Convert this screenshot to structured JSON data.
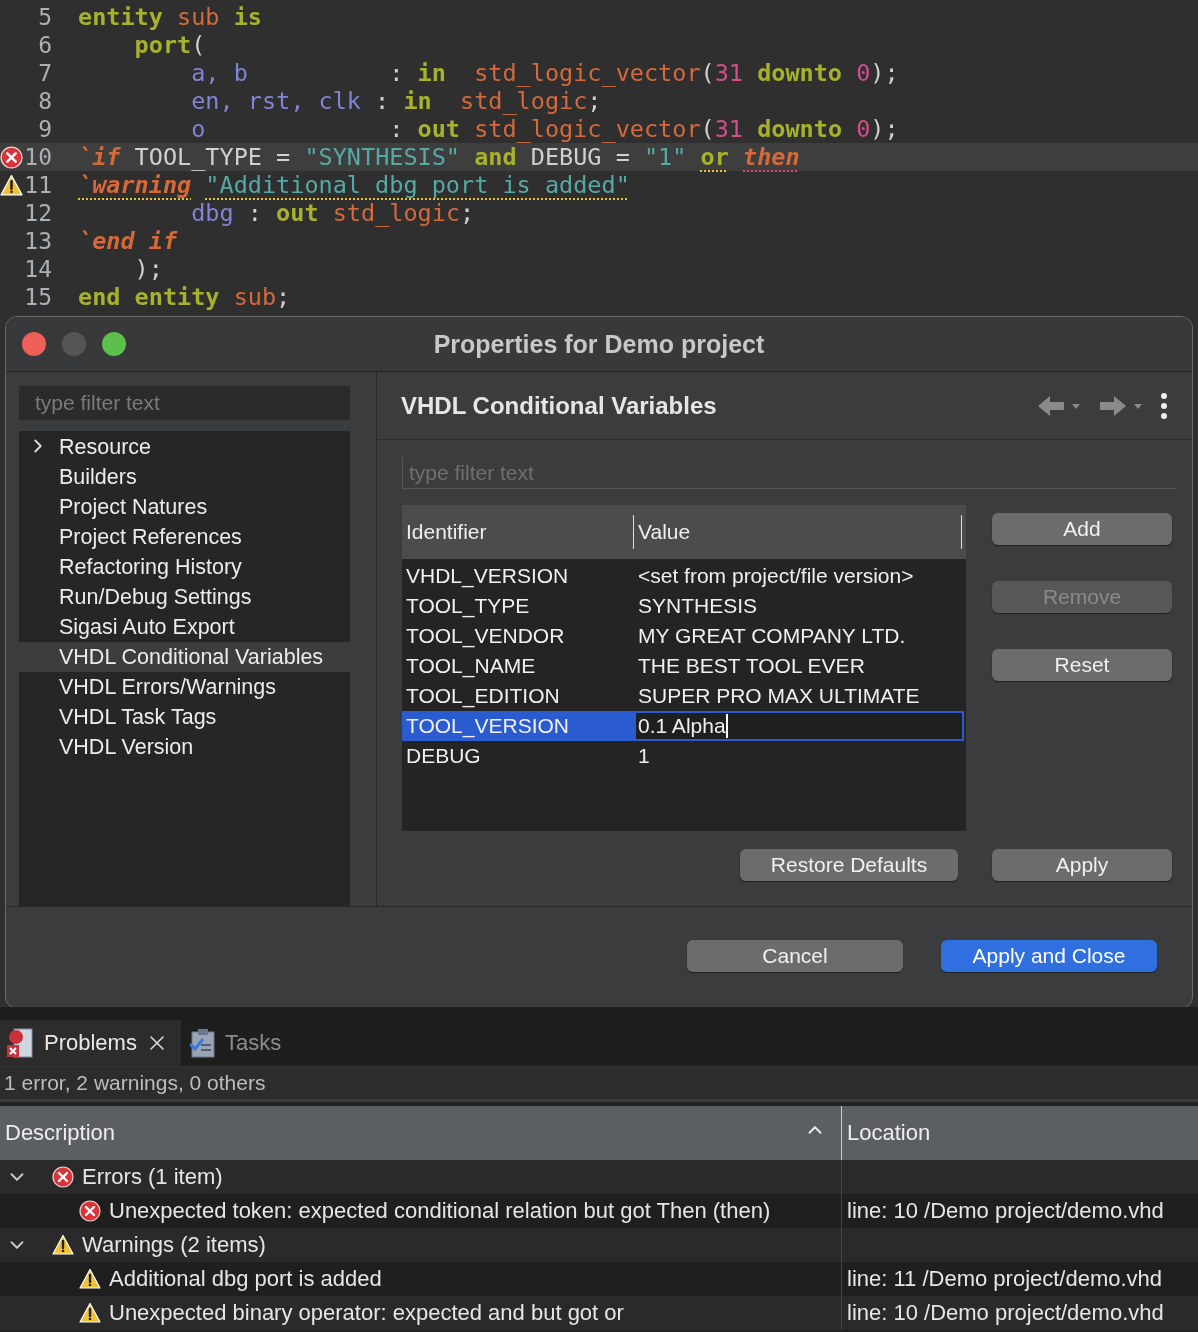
{
  "editor": {
    "lines": [
      {
        "number": "5",
        "kind": "code",
        "current": false,
        "tokens": [
          {
            "text": "entity",
            "kind": "keyword"
          },
          {
            "text": " sub",
            "kind": "type"
          },
          {
            "text": " is",
            "kind": "keyword"
          }
        ]
      },
      {
        "number": "6",
        "kind": "code",
        "current": false,
        "tokens": [
          {
            "text": "    port",
            "kind": "keyword"
          },
          {
            "text": "(",
            "kind": "plain"
          }
        ]
      },
      {
        "number": "7",
        "kind": "code",
        "current": false,
        "tokens": [
          {
            "text": "        a, b",
            "kind": "identifier"
          },
          {
            "text": "          : ",
            "kind": "plain"
          },
          {
            "text": "in",
            "kind": "keyword"
          },
          {
            "text": "  std_logic_vector",
            "kind": "type"
          },
          {
            "text": "(",
            "kind": "plain"
          },
          {
            "text": "31",
            "kind": "number"
          },
          {
            "text": " downto ",
            "kind": "keyword"
          },
          {
            "text": "0",
            "kind": "number"
          },
          {
            "text": ");",
            "kind": "plain"
          }
        ]
      },
      {
        "number": "8",
        "kind": "code",
        "current": false,
        "tokens": [
          {
            "text": "        en, rst, clk",
            "kind": "identifier"
          },
          {
            "text": " : ",
            "kind": "plain"
          },
          {
            "text": "in",
            "kind": "keyword"
          },
          {
            "text": "  std_logic",
            "kind": "type"
          },
          {
            "text": ";",
            "kind": "plain"
          }
        ]
      },
      {
        "number": "9",
        "kind": "code",
        "current": false,
        "tokens": [
          {
            "text": "        o",
            "kind": "identifier"
          },
          {
            "text": "             : ",
            "kind": "plain"
          },
          {
            "text": "out",
            "kind": "keyword"
          },
          {
            "text": " std_logic_vector",
            "kind": "type"
          },
          {
            "text": "(",
            "kind": "plain"
          },
          {
            "text": "31",
            "kind": "number"
          },
          {
            "text": " downto ",
            "kind": "keyword"
          },
          {
            "text": "0",
            "kind": "number"
          },
          {
            "text": ");",
            "kind": "plain"
          }
        ]
      },
      {
        "number": "10",
        "kind": "error",
        "current": true,
        "tokens": [
          {
            "text": "`if",
            "kind": "directive"
          },
          {
            "text": " TOOL_TYPE = ",
            "kind": "plain"
          },
          {
            "text": "\"SYNTHESIS\"",
            "kind": "string"
          },
          {
            "text": " and",
            "kind": "keyword"
          },
          {
            "text": " DEBUG = ",
            "kind": "plain"
          },
          {
            "text": "\"1\"",
            "kind": "string"
          },
          {
            "text": " or",
            "kind": "keyword",
            "warning_mark": true
          },
          {
            "text": " then",
            "kind": "directive",
            "error_mark": true
          }
        ]
      },
      {
        "number": "11",
        "kind": "warning",
        "current": false,
        "tokens": [
          {
            "text": "`warning",
            "kind": "directive",
            "warning_mark": true
          },
          {
            "text": " \"Additional dbg port is added\"",
            "kind": "string",
            "warning_mark": true
          }
        ]
      },
      {
        "number": "12",
        "kind": "code",
        "current": false,
        "tokens": [
          {
            "text": "        dbg",
            "kind": "identifier"
          },
          {
            "text": " : ",
            "kind": "plain"
          },
          {
            "text": "out",
            "kind": "keyword"
          },
          {
            "text": " std_logic",
            "kind": "type"
          },
          {
            "text": ";",
            "kind": "plain"
          }
        ]
      },
      {
        "number": "13",
        "kind": "code",
        "current": false,
        "tokens": [
          {
            "text": "`end if",
            "kind": "directive"
          }
        ]
      },
      {
        "number": "14",
        "kind": "code",
        "current": false,
        "tokens": [
          {
            "text": "    );",
            "kind": "plain"
          }
        ]
      },
      {
        "number": "15",
        "kind": "code",
        "current": false,
        "tokens": [
          {
            "text": "end entity",
            "kind": "keyword"
          },
          {
            "text": " sub",
            "kind": "type"
          },
          {
            "text": ";",
            "kind": "plain"
          }
        ]
      }
    ]
  },
  "dialog": {
    "title": "Properties for Demo project",
    "sidebar": {
      "filter_placeholder": "type filter text",
      "items": [
        {
          "label": "Resource",
          "kind": "folder",
          "selected": false
        },
        {
          "label": "Builders",
          "kind": "page",
          "selected": false
        },
        {
          "label": "Project Natures",
          "kind": "page",
          "selected": false
        },
        {
          "label": "Project References",
          "kind": "page",
          "selected": false
        },
        {
          "label": "Refactoring History",
          "kind": "page",
          "selected": false
        },
        {
          "label": "Run/Debug Settings",
          "kind": "page",
          "selected": false
        },
        {
          "label": "Sigasi Auto Export",
          "kind": "page",
          "selected": false
        },
        {
          "label": "VHDL Conditional Variables",
          "kind": "page",
          "selected": true
        },
        {
          "label": "VHDL Errors/Warnings",
          "kind": "page",
          "selected": false
        },
        {
          "label": "VHDL Task Tags",
          "kind": "page",
          "selected": false
        },
        {
          "label": "VHDL Version",
          "kind": "page",
          "selected": false
        }
      ]
    },
    "page": {
      "title": "VHDL Conditional Variables",
      "filter_placeholder": "type filter text",
      "columns": [
        "Identifier",
        "Value"
      ],
      "rows": [
        {
          "identifier": "VHDL_VERSION",
          "value": "<set from project/file version>",
          "selected": false
        },
        {
          "identifier": "TOOL_TYPE",
          "value": "SYNTHESIS",
          "selected": false
        },
        {
          "identifier": "TOOL_VENDOR",
          "value": "MY GREAT COMPANY LTD.",
          "selected": false
        },
        {
          "identifier": "TOOL_NAME",
          "value": "THE BEST TOOL EVER",
          "selected": false
        },
        {
          "identifier": "TOOL_EDITION",
          "value": "SUPER PRO MAX ULTIMATE",
          "selected": false
        },
        {
          "identifier": "TOOL_VERSION",
          "value": "0.1 Alpha",
          "selected": true
        },
        {
          "identifier": "DEBUG",
          "value": "1",
          "selected": false
        }
      ],
      "side_buttons": [
        {
          "label": "Add",
          "disabled": false
        },
        {
          "label": "Remove",
          "disabled": true
        },
        {
          "label": "Reset",
          "disabled": false
        }
      ],
      "restore_defaults": "Restore Defaults",
      "apply": "Apply"
    },
    "footer_buttons": [
      {
        "label": "Cancel",
        "kind": "normal"
      },
      {
        "label": "Apply and Close",
        "kind": "primary"
      }
    ]
  },
  "problems": {
    "tabs": [
      {
        "label": "Problems",
        "selected": true
      },
      {
        "label": "Tasks",
        "selected": false
      }
    ],
    "summary": "1 error, 2 warnings, 0 others",
    "columns": [
      "Description",
      "Location"
    ],
    "groups": [
      {
        "label": "Errors (1 item)",
        "kind": "error",
        "expanded": true,
        "items": [
          {
            "description": "Unexpected token: expected conditional relation but got Then (then)",
            "location": "line: 10 /Demo project/demo.vhd",
            "kind": "error"
          }
        ]
      },
      {
        "label": "Warnings (2 items)",
        "kind": "warning",
        "expanded": true,
        "items": [
          {
            "description": "Additional dbg port is added",
            "location": "line: 11 /Demo project/demo.vhd",
            "kind": "warning"
          },
          {
            "description": "Unexpected binary operator: expected and but got or",
            "location": "line: 10 /Demo project/demo.vhd",
            "kind": "warning"
          }
        ]
      }
    ]
  }
}
